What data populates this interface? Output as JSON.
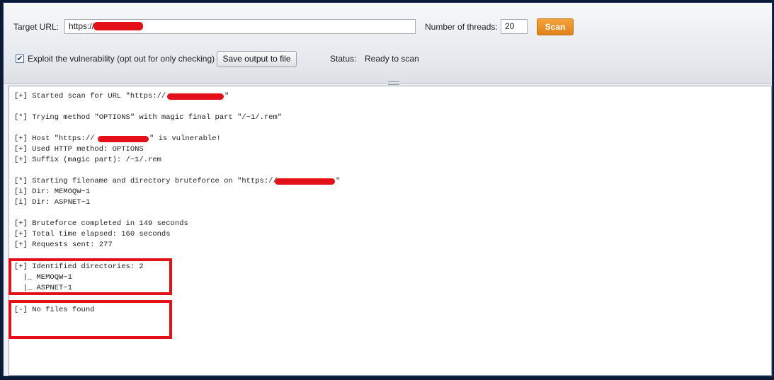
{
  "toolbar": {
    "target_url_label": "Target URL:",
    "target_url_value": "https://",
    "threads_label": "Number of threads:",
    "threads_value": "20",
    "scan_label": "Scan",
    "exploit_label": "Exploit the vulnerability (opt out for only checking)",
    "exploit_checked": true,
    "save_label": "Save output to file",
    "status_label": "Status:",
    "status_value": "Ready to scan"
  },
  "colors": {
    "accent": "#e0821a",
    "redaction": "#e3101a",
    "highlight": "#e3101a"
  },
  "output": {
    "lines": [
      "[+] Started scan for URL \"https://",
      "\"",
      "[*] Trying method \"OPTIONS\" with magic final part \"/~1/.rem\"",
      "[+] Host \"https://",
      "\" is vulnerable!",
      "[+] Used HTTP method: OPTIONS",
      "[+] Suffix (magic part): /~1/.rem",
      "[*] Starting filename and directory bruteforce on \"https://",
      "\"",
      "[i] Dir: MEMOQW~1",
      "[i] Dir: ASPNET~1",
      "[+] Bruteforce completed in 149 seconds",
      "[+] Total time elapsed: 160 seconds",
      "[+] Requests sent: 277",
      "[+] Identified directories: 2",
      "  |_ MEMOQW~1",
      "  |_ ASPNET~1",
      "[-] No files found"
    ]
  }
}
